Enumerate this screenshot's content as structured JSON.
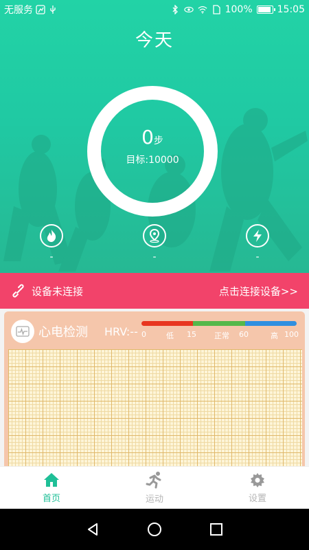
{
  "status_bar": {
    "carrier": "无服务",
    "battery_percent": "100%",
    "time": "15:05",
    "icons": [
      "run-icon",
      "usb-icon",
      "bluetooth-icon",
      "eye-icon",
      "wifi-icon",
      "sim-icon",
      "battery-icon"
    ]
  },
  "hero": {
    "title": "今天",
    "steps_value": "0",
    "steps_unit": "步",
    "target_label": "目标:10000",
    "stats": [
      {
        "icon": "flame-icon",
        "value": "-"
      },
      {
        "icon": "location-icon",
        "value": "-"
      },
      {
        "icon": "lightning-icon",
        "value": "-"
      }
    ]
  },
  "connect_bar": {
    "status_label": "设备未连接",
    "action_label": "点击连接设备>>",
    "color": "#f2436a"
  },
  "ecg": {
    "title": "心电检测",
    "hrv_label": "HRV:--",
    "scale": {
      "ticks": [
        "0",
        "低",
        "15",
        "正常",
        "60",
        "高",
        "100"
      ],
      "colors": [
        "#e8361f",
        "#55b84a",
        "#2f8fe0"
      ]
    }
  },
  "tabs": [
    {
      "label": "首页",
      "icon": "home-icon",
      "active": true
    },
    {
      "label": "运动",
      "icon": "running-icon",
      "active": false
    },
    {
      "label": "设置",
      "icon": "gear-icon",
      "active": false
    }
  ],
  "accent_color": "#1fbf97"
}
